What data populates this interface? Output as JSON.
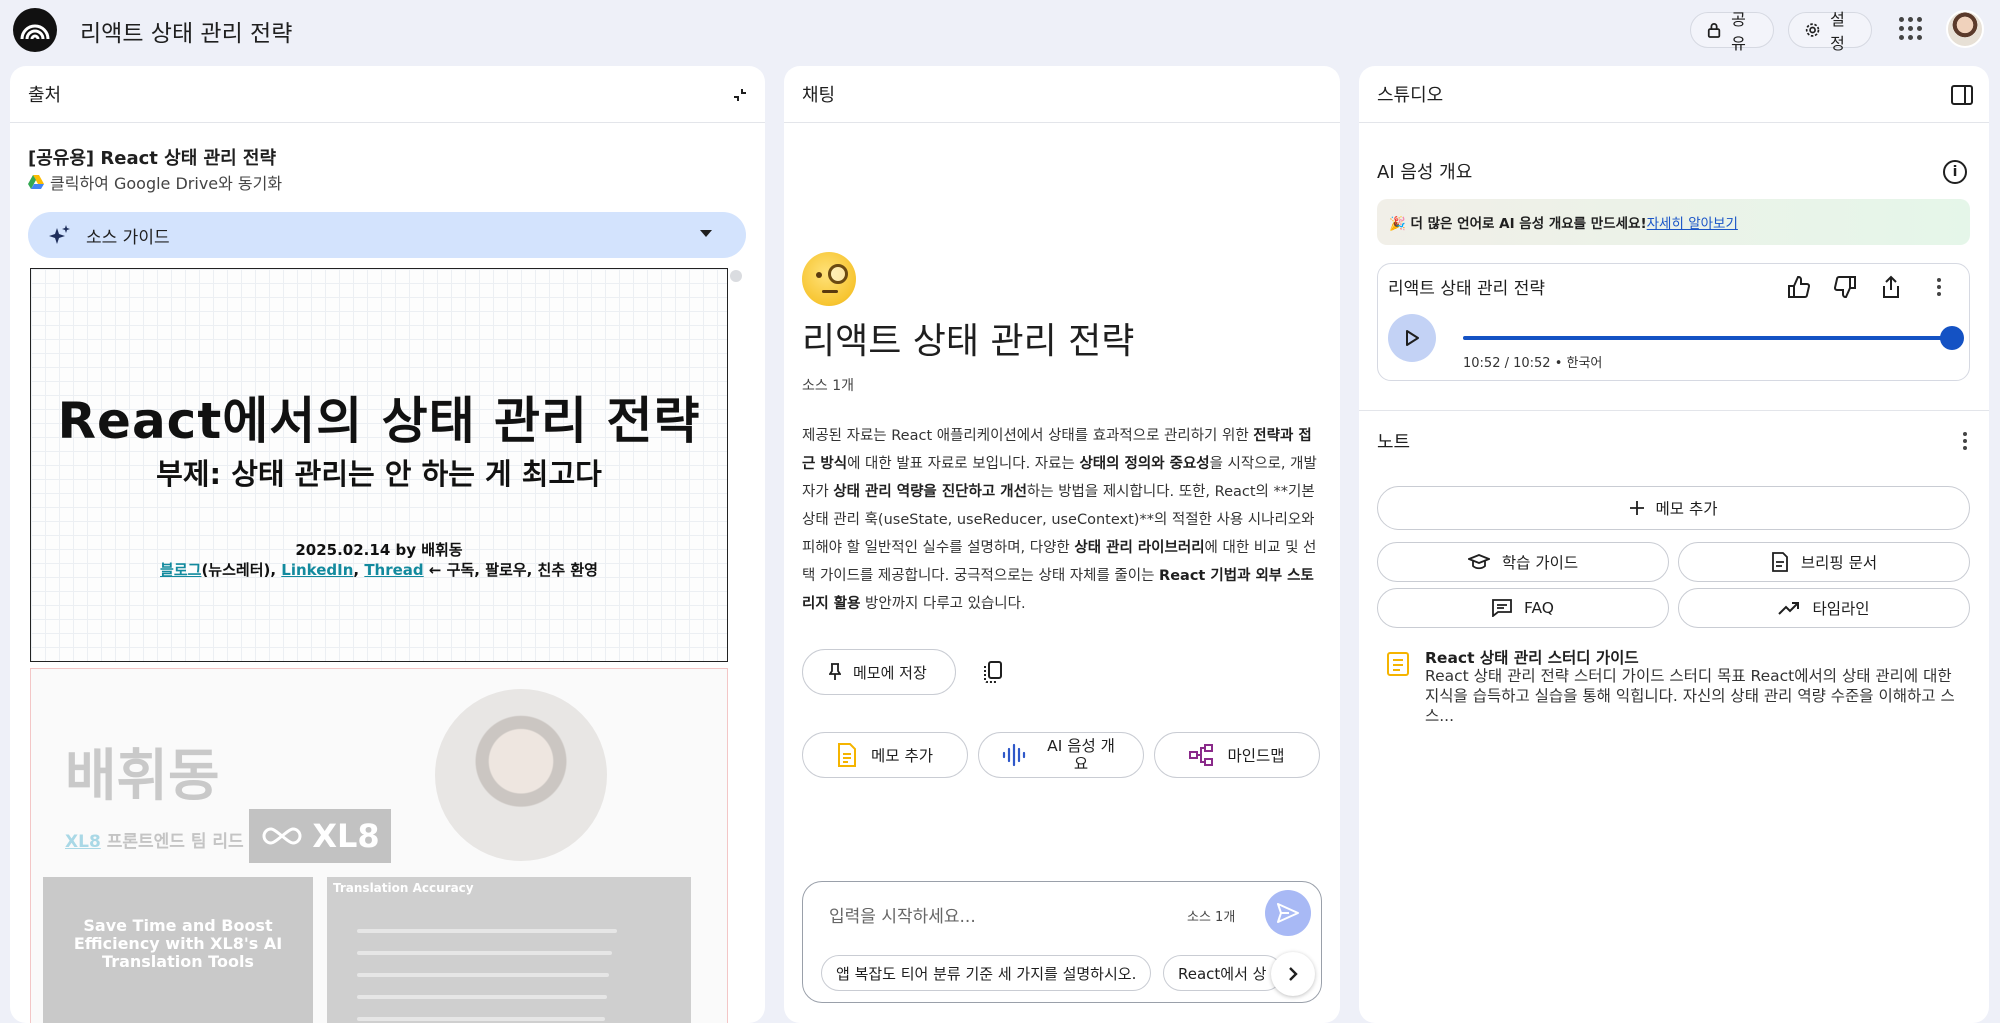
{
  "header": {
    "app_title": "리액트 상태 관리 전략",
    "share_label": "공유",
    "settings_label": "설정"
  },
  "sources": {
    "panel_title": "출처",
    "source_title": "[공유용] React 상태 관리 전략",
    "drive_sync": "클릭하여 Google Drive와 동기화",
    "guide_label": "소스 가이드",
    "slide1": {
      "heading": "React에서의 상태 관리 전략",
      "subheading": "부제: 상태 관리는 안 하는 게 최고다",
      "date_author": "2025.02.14 by 배휘동",
      "link_blog": "블로그",
      "link_blog_suffix": "(뉴스레터), ",
      "link_linkedin": "LinkedIn",
      "sep": ", ",
      "link_thread": "Thread",
      "links_tail": " ← 구독, 팔로우, 친추 환영"
    },
    "slide2": {
      "name": "배휘동",
      "company_link": "XL8",
      "role": " 프론트엔드 팀 리드",
      "logo_text": "XL8",
      "card1_text": "Save Time and Boost Efficiency with XL8's AI Translation Tools",
      "card2_title": "Translation Accuracy"
    }
  },
  "chat": {
    "panel_title": "채팅",
    "title": "리액트 상태 관리 전략",
    "source_count": "소스 1개",
    "summary": {
      "p1": "제공된 자료는 React 애플리케이션에서 상태를 효과적으로 관리하기 위한 ",
      "b1": "전략과 접근 방식",
      "p2": "에 대한 발표 자료로 보입니다. 자료는 ",
      "b2": "상태의 정의와 중요성",
      "p3": "을 시작으로, 개발자가 ",
      "b3": "상태 관리 역량을 진단하고 개선",
      "p4": "하는 방법을 제시합니다. 또한, React의 **기본 상태 관리 훅(useState, useReducer, useContext)**의 적절한 사용 시나리오와 피해야 할 일반적인 실수를 설명하며, 다양한 ",
      "b4": "상태 관리 라이브러리",
      "p5": "에 대한 비교 및 선택 가이드를 제공합니다. 궁극적으로는 상태 자체를 줄이는 ",
      "b5": "React 기법과 외부 스토리지 활용",
      "p6": " 방안까지 다루고 있습니다."
    },
    "save_memo": "메모에 저장",
    "actions": [
      "메모 추가",
      "AI 음성 개요",
      "마인드맵"
    ],
    "input_placeholder": "입력을 시작하세요...",
    "input_source_count": "소스 1개",
    "suggestions": [
      "앱 복잡도 티어 분류 기준 세 가지를 설명하시오.",
      "React에서 상"
    ]
  },
  "studio": {
    "panel_title": "스튜디오",
    "audio_section": "AI 음성 개요",
    "promo_text": "🎉 더 많은 언어로 AI 음성 개요를 만드세요!",
    "promo_link": "자세히 알아보기",
    "audio_title": "리액트 상태 관리 전략",
    "audio_time": "10:52 / 10:52 • 한국어",
    "audio_progress": 1.0,
    "notes_section": "노트",
    "add_memo": "메모 추가",
    "note_buttons": [
      "학습 가이드",
      "브리핑 문서",
      "FAQ",
      "타임라인"
    ],
    "note": {
      "title": "React 상태 관리 스터디 가이드",
      "body": "React 상태 관리 전략 스터디 가이드 스터디 목표 React에서의 상태 관리에 대한 지식을 습득하고 실습을 통해 익힙니다. 자신의 상태 관리 역량 수준을 이해하고 스스..."
    }
  },
  "colors": {
    "background": "#eef0f8",
    "guide_bar": "#d3e3fd",
    "accent_blue": "#1452c4",
    "send_button": "#a8b9f5"
  }
}
